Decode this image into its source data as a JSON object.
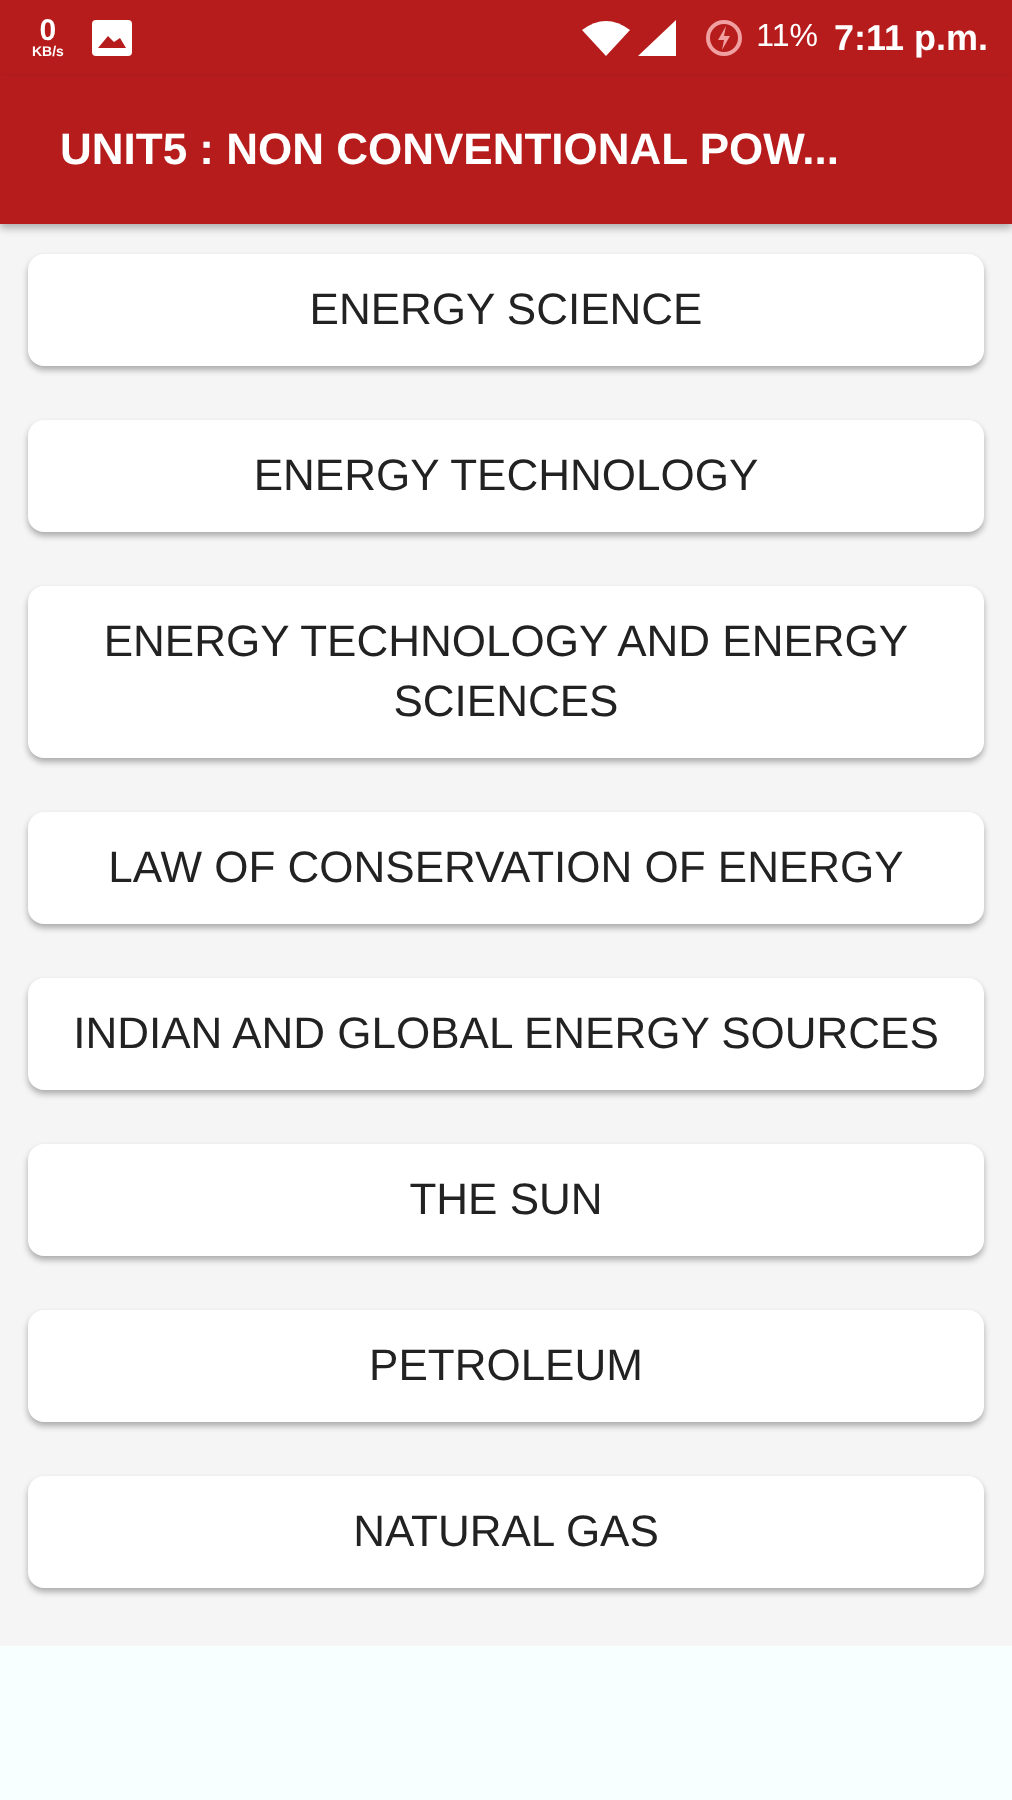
{
  "status_bar": {
    "speed_value": "0",
    "speed_unit": "KB/s",
    "battery": "11%",
    "time": "7:11 p.m."
  },
  "app_bar": {
    "title": "UNIT5 : NON CONVENTIONAL POW..."
  },
  "topics": [
    {
      "label": "ENERGY SCIENCE"
    },
    {
      "label": "ENERGY TECHNOLOGY"
    },
    {
      "label": "ENERGY TECHNOLOGY AND ENERGY SCIENCES"
    },
    {
      "label": "LAW OF CONSERVATION OF ENERGY"
    },
    {
      "label": "INDIAN AND GLOBAL ENERGY SOURCES"
    },
    {
      "label": "THE SUN"
    },
    {
      "label": "PETROLEUM"
    },
    {
      "label": "NATURAL GAS"
    }
  ]
}
